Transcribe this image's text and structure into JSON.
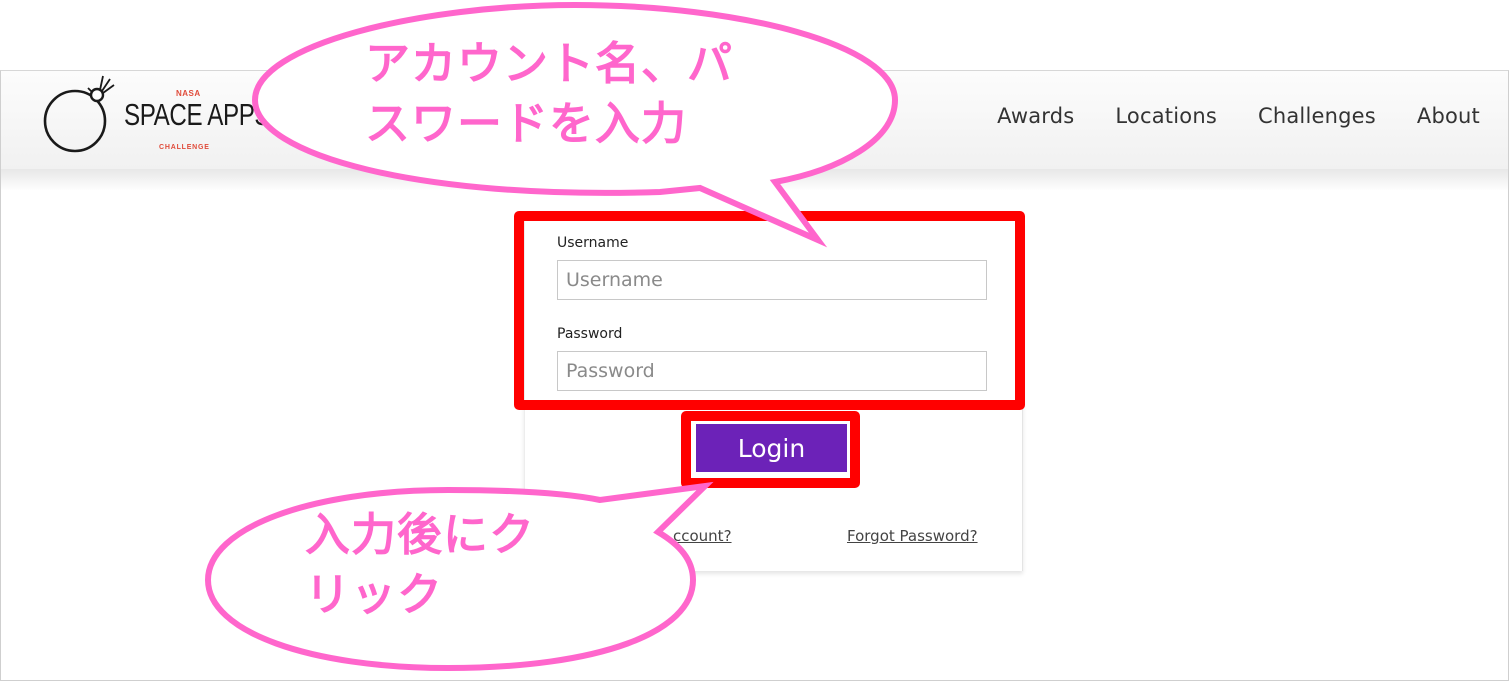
{
  "logo": {
    "agency": "NASA",
    "title": "SPACE APPS",
    "subtitle": "CHALLENGE"
  },
  "nav": {
    "items": [
      {
        "label": "Awards"
      },
      {
        "label": "Locations"
      },
      {
        "label": "Challenges"
      },
      {
        "label": "About"
      }
    ]
  },
  "form": {
    "username_label": "Username",
    "username_placeholder": "Username",
    "username_value": "",
    "password_label": "Password",
    "password_placeholder": "Password",
    "password_value": "",
    "login_label": "Login",
    "create_account_link": "ccount?",
    "forgot_password_link": "Forgot Password?"
  },
  "annotations": {
    "callout_top": "アカウント名、パ\nスワードを入力",
    "callout_bottom": "入力後にク\nリック"
  },
  "colors": {
    "accent_purple": "#6c22b8",
    "highlight_red": "#ff0000",
    "callout_pink": "#ff66cc",
    "nasa_red": "#e04b3a"
  }
}
